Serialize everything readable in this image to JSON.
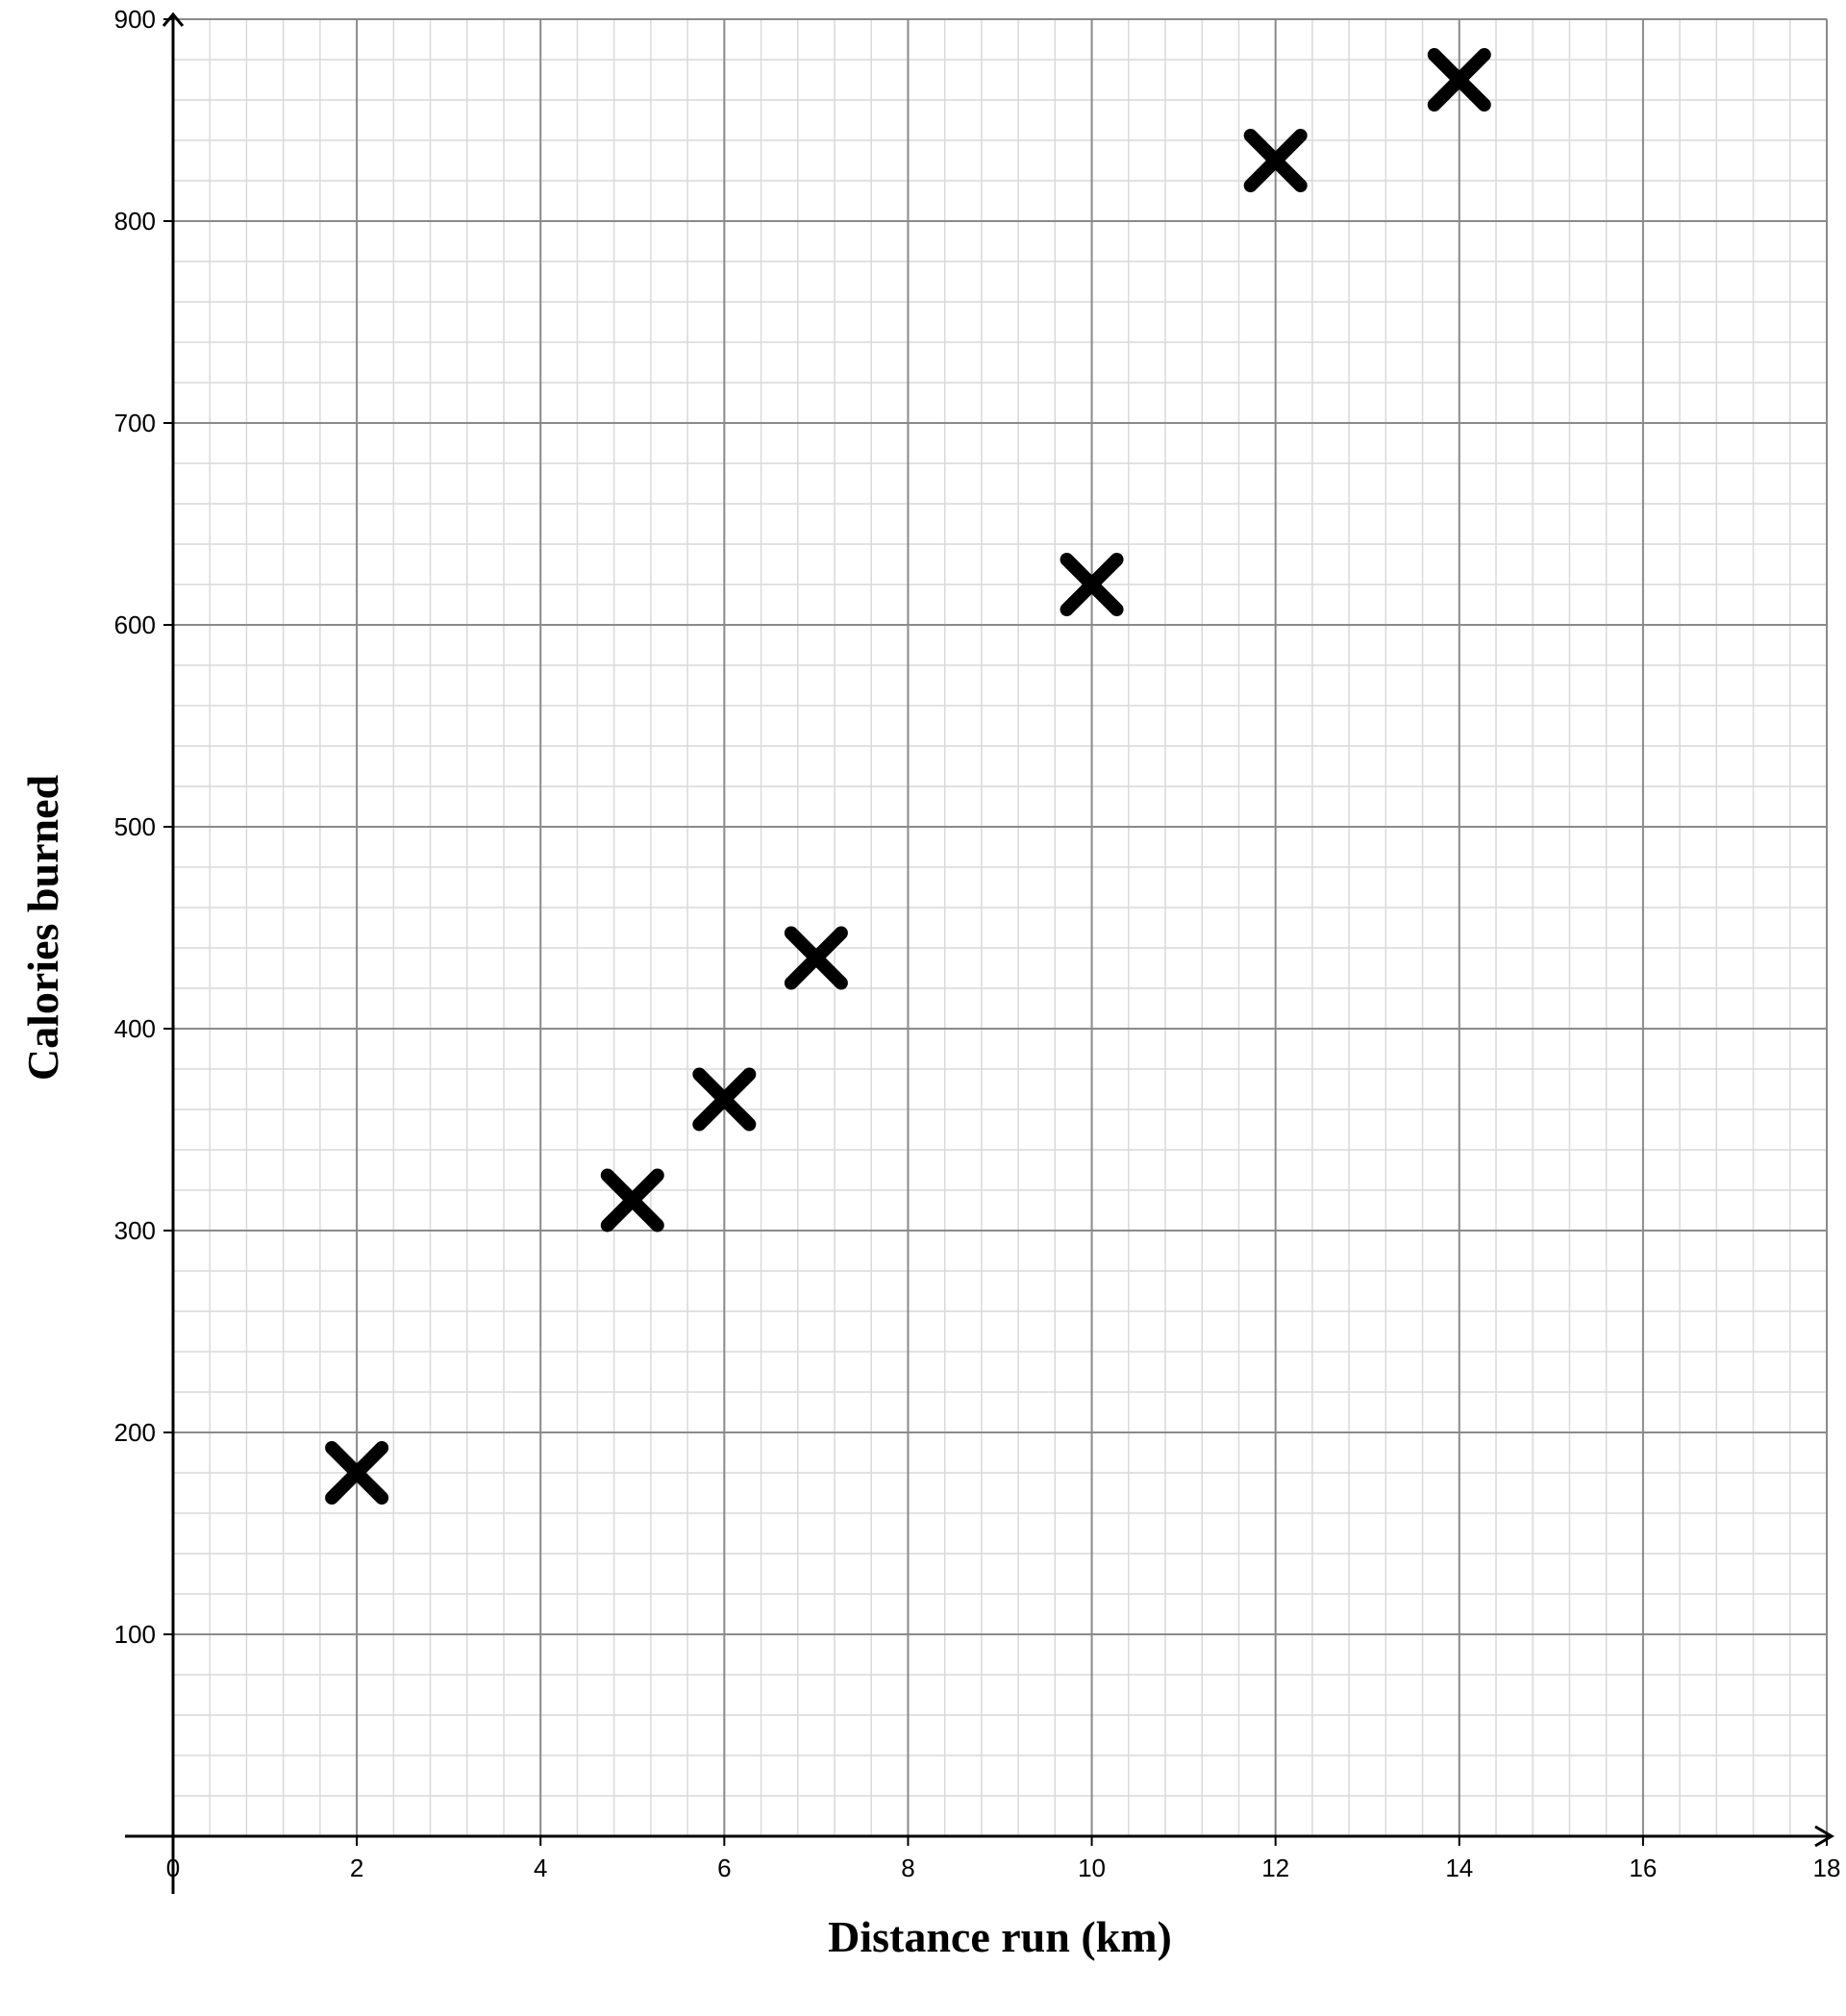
{
  "chart_data": {
    "type": "scatter",
    "title": "",
    "xlabel": "Distance run (km)",
    "ylabel": "Calories burned",
    "xlim": [
      0,
      18
    ],
    "ylim": [
      0,
      900
    ],
    "xticks": [
      0,
      2,
      4,
      6,
      8,
      10,
      12,
      14,
      16,
      18
    ],
    "yticks": [
      100,
      200,
      300,
      400,
      500,
      600,
      700,
      800,
      900
    ],
    "x_minor_step": 0.4,
    "y_minor_step": 20,
    "points": [
      {
        "x": 2,
        "y": 180
      },
      {
        "x": 5,
        "y": 315
      },
      {
        "x": 6,
        "y": 365
      },
      {
        "x": 7,
        "y": 435
      },
      {
        "x": 10,
        "y": 620
      },
      {
        "x": 12,
        "y": 830
      },
      {
        "x": 14,
        "y": 870
      }
    ],
    "marker": "x",
    "colors": {
      "minor_grid": "#d9d9d9",
      "major_grid": "#8a8a8a",
      "axis": "#000000",
      "marker": "#000000"
    }
  }
}
